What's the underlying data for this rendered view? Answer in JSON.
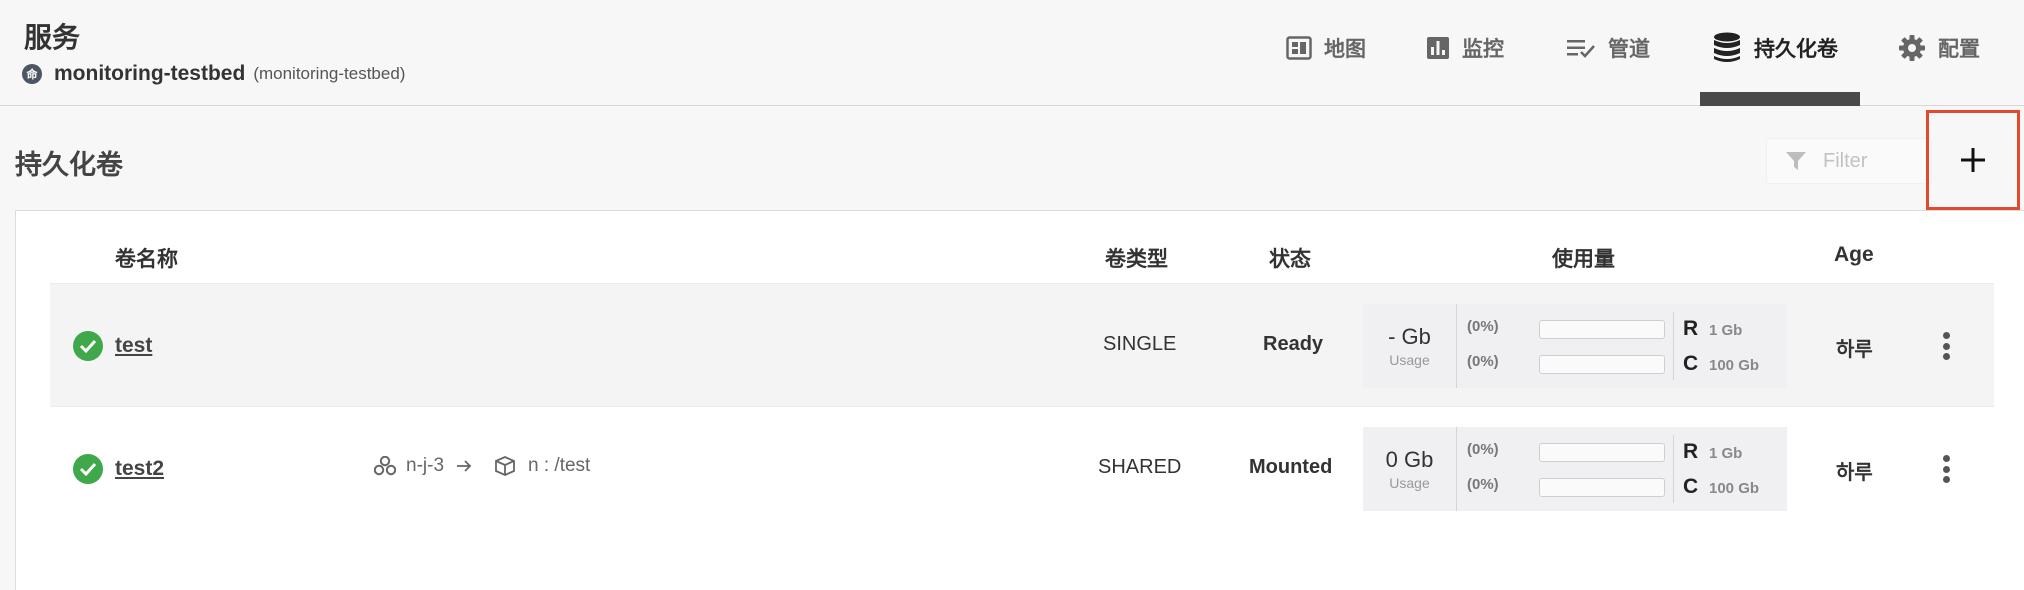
{
  "header": {
    "service_title": "服务",
    "namespace_badge": "命",
    "namespace_name": "monitoring-testbed",
    "namespace_sub": "(monitoring-testbed)",
    "tabs": [
      {
        "label": "地图",
        "icon": "map-icon"
      },
      {
        "label": "监控",
        "icon": "chart-icon"
      },
      {
        "label": "管道",
        "icon": "pipeline-icon"
      },
      {
        "label": "持久化卷",
        "icon": "database-icon",
        "active": true
      },
      {
        "label": "配置",
        "icon": "gear-icon"
      }
    ]
  },
  "page": {
    "title": "持久化卷",
    "filter_placeholder": "Filter",
    "add_label": "+"
  },
  "table": {
    "columns": {
      "name": "卷名称",
      "type": "卷类型",
      "status": "状态",
      "usage": "使用量",
      "age": "Age"
    },
    "rows": [
      {
        "name": "test",
        "status_icon": "check-circle-icon",
        "mount_node": "",
        "mount_path": "",
        "type": "SINGLE",
        "status": "Ready",
        "usage_value": "- Gb",
        "usage_label": "Usage",
        "request_pct": "(0%)",
        "capacity_pct": "(0%)",
        "request_letter": "R",
        "request_size": "1 Gb",
        "capacity_letter": "C",
        "capacity_size": "100 Gb",
        "request_fill": 0,
        "capacity_fill": 0,
        "age": "하루"
      },
      {
        "name": "test2",
        "status_icon": "check-circle-icon",
        "mount_node": "n-j-3",
        "mount_path": "n : /test",
        "type": "SHARED",
        "status": "Mounted",
        "usage_value": "0 Gb",
        "usage_label": "Usage",
        "request_pct": "(0%)",
        "capacity_pct": "(0%)",
        "request_letter": "R",
        "request_size": "1 Gb",
        "capacity_letter": "C",
        "capacity_size": "100 Gb",
        "request_fill": 0,
        "capacity_fill": 0,
        "age": "하루"
      }
    ]
  },
  "colors": {
    "accent_highlight": "#e14a2c",
    "status_ok": "#3ea84a",
    "active_tab_bar": "#4a4a4a"
  }
}
